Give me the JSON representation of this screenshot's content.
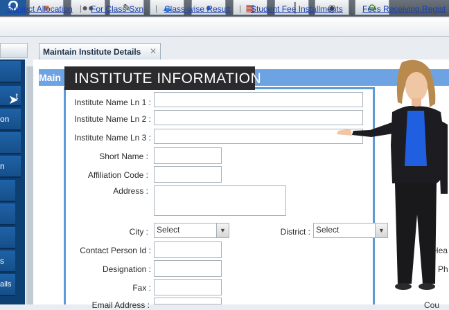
{
  "logo": {
    "text": "O"
  },
  "toolbar": {
    "icons": [
      "person-icon",
      "people-icon",
      "pen-icon",
      "cloud-icon",
      "users-icon",
      "calendar-icon",
      "desk-icon",
      "money-icon",
      "settings-icon"
    ]
  },
  "links": {
    "items": [
      "Subject Allocation",
      "For Class-Sxn",
      "Class-wise Result",
      "Student Fee Installments",
      "Fees Receiving Regist"
    ],
    "separator": "|"
  },
  "sidebar": {
    "items": [
      "t",
      "on",
      "",
      "n",
      "",
      "",
      "",
      "s",
      "ails"
    ]
  },
  "tab": {
    "label": "Maintain Institute Details",
    "close": "✕"
  },
  "title_strip": {
    "text": "Main"
  },
  "banner": {
    "text": "INSTITUTE INFORMATION"
  },
  "form": {
    "name1_label": "Institute Name Ln 1 :",
    "name2_label": "Institute Name Ln 2 :",
    "name3_label": "Institute Name Ln 3 :",
    "short_name_label": "Short Name :",
    "affiliation_label": "Affiliation Code :",
    "address_label": "Address :",
    "city_label": "City :",
    "city_value": "Select",
    "district_label": "District :",
    "district_value": "Select",
    "contact_label": "Contact Person Id :",
    "designation_label": "Designation :",
    "fax_label": "Fax :",
    "cutoff_label": "Email Address :",
    "right_edge_1": "Hea",
    "right_edge_2": "Ph",
    "right_edge_3": "Cou"
  },
  "colors": {
    "accent": "#5c9ad8",
    "sidebar": "#164f8a",
    "banner": "#2b2b2e",
    "link": "#1a3fb0"
  }
}
